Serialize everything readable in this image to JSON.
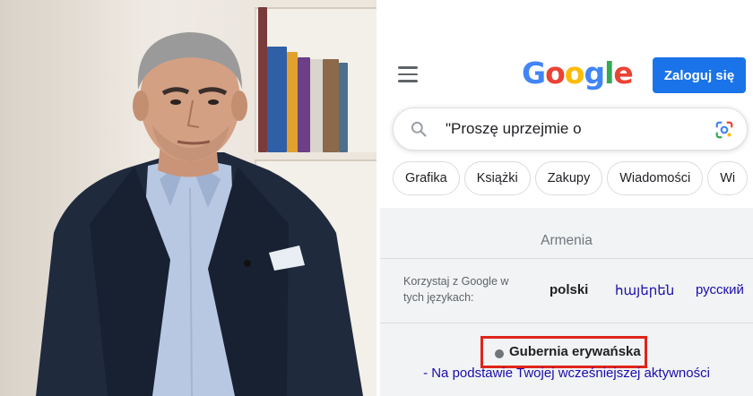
{
  "photo": {
    "subject": "man-in-suit-portrait"
  },
  "google": {
    "logo": {
      "letters": [
        "G",
        "o",
        "o",
        "g",
        "l",
        "e"
      ]
    },
    "login_label": "Zaloguj się",
    "search": {
      "query": "\"Proszę uprzejmie o"
    },
    "chips": [
      "Grafika",
      "Książki",
      "Zakupy",
      "Wiadomości",
      "Wi"
    ],
    "footer": {
      "country": "Armenia",
      "languages_label": "Korzystaj z Google w tych językach:",
      "languages": [
        "polski",
        "հայերեն",
        "русский"
      ],
      "location": "Gubernia erywańska",
      "location_source": "- Na podstawie Twojej wcześniejszej aktywności"
    }
  },
  "colors": {
    "google_blue": "#4285f4",
    "google_red": "#ea4335",
    "google_yellow": "#fbbc05",
    "google_green": "#34a853",
    "button_blue": "#1a73e8",
    "link_blue": "#1a0dab",
    "highlight_red": "#e0241a"
  }
}
